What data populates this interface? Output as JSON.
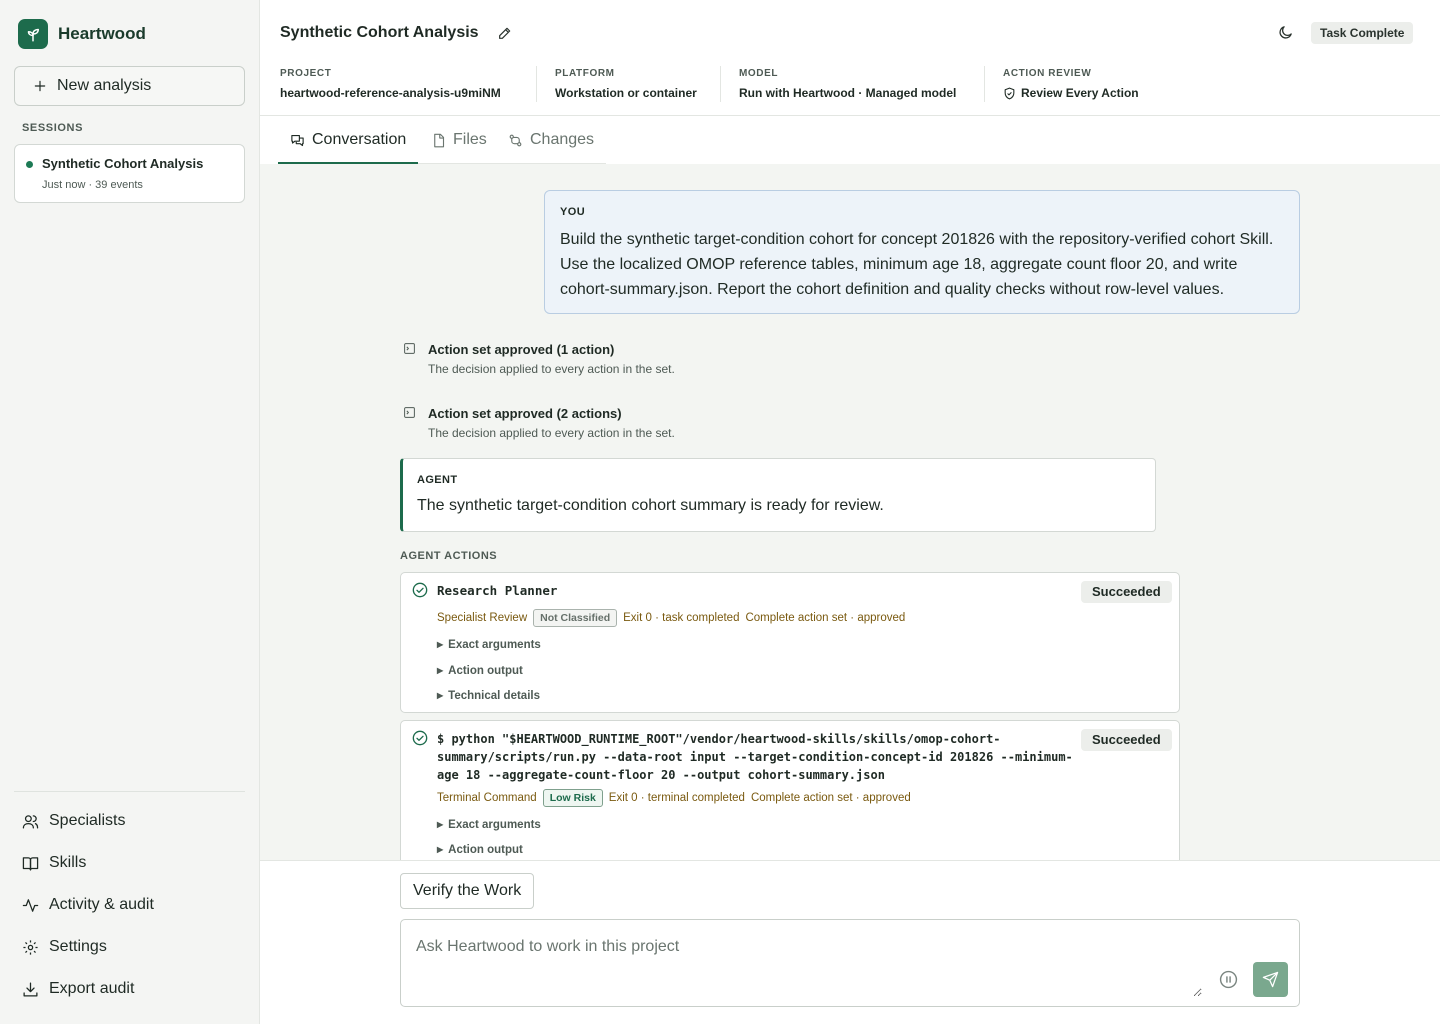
{
  "app": {
    "name": "Heartwood",
    "new_analysis_label": "New analysis",
    "sessions_label": "SESSIONS",
    "accent_color": "#1d6b4c"
  },
  "sessions": [
    {
      "title": "Synthetic Cohort Analysis",
      "meta": "Just now · 39 events"
    }
  ],
  "nav": {
    "specialists": "Specialists",
    "skills": "Skills",
    "activity": "Activity & audit",
    "settings": "Settings",
    "export": "Export audit"
  },
  "header": {
    "title": "Synthetic Cohort Analysis",
    "status": "Task Complete",
    "project_label": "PROJECT",
    "project_value": "heartwood-reference-analysis-u9miNM",
    "platform_label": "PLATFORM",
    "platform_value": "Workstation or container",
    "model_label": "MODEL",
    "model_value": "Run with Heartwood · Managed model",
    "review_label": "ACTION REVIEW",
    "review_value": "Review Every Action"
  },
  "tabs": [
    {
      "label": "Conversation",
      "active": true
    },
    {
      "label": "Files",
      "active": false
    },
    {
      "label": "Changes",
      "active": false
    }
  ],
  "conversation": {
    "you_label": "YOU",
    "you_text": "Build the synthetic target-condition cohort for concept 201826 with the repository-verified cohort Skill. Use the localized OMOP reference tables, minimum age 18, aggregate count floor 20, and write cohort-summary.json. Report the cohort definition and quality checks without row-level values.",
    "events": [
      {
        "title": "Action set approved (1 action)",
        "subtitle": "The decision applied to every action in the set."
      },
      {
        "title": "Action set approved (2 actions)",
        "subtitle": "The decision applied to every action in the set."
      }
    ],
    "agent_label": "AGENT",
    "agent_text": "The synthetic target-condition cohort summary is ready for review.",
    "actions_heading": "AGENT ACTIONS",
    "actions": [
      {
        "title": "Research Planner",
        "result": "Succeeded",
        "kind": "Specialist Review",
        "risk": "Not Classified",
        "exit": "Exit 0 · task completed",
        "set": "Complete action set · approved",
        "details": [
          "Exact arguments",
          "Action output",
          "Technical details"
        ]
      },
      {
        "title": "$ python \"$HEARTWOOD_RUNTIME_ROOT\"/vendor/heartwood-skills/skills/omop-cohort-summary/scripts/run.py --data-root input --target-condition-concept-id 201826 --minimum-age 18 --aggregate-count-floor 20 --output cohort-summary.json",
        "result": "Succeeded",
        "kind": "Terminal Command",
        "risk": "Low Risk",
        "exit": "Exit 0 · terminal completed",
        "set": "Complete action set · approved",
        "details": [
          "Exact arguments",
          "Action output"
        ]
      }
    ]
  },
  "composer": {
    "suggestion": "Verify the Work",
    "placeholder": "Ask Heartwood to work in this project"
  }
}
